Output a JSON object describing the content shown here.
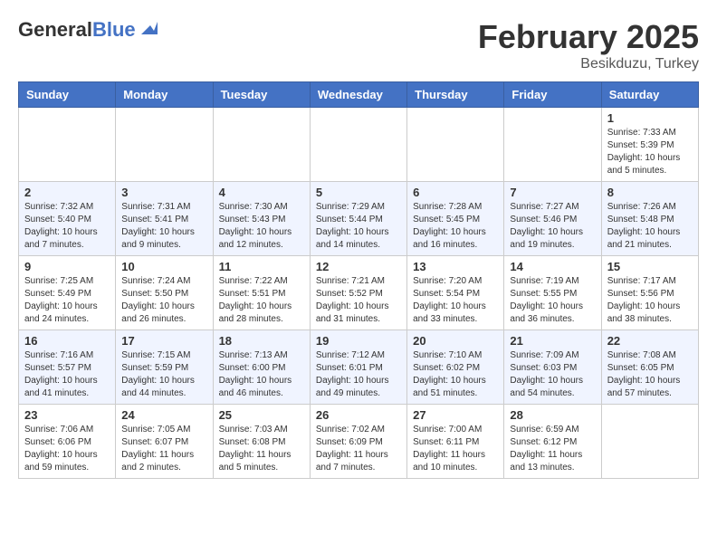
{
  "header": {
    "logo_general": "General",
    "logo_blue": "Blue",
    "month_title": "February 2025",
    "location": "Besikduzu, Turkey"
  },
  "weekdays": [
    "Sunday",
    "Monday",
    "Tuesday",
    "Wednesday",
    "Thursday",
    "Friday",
    "Saturday"
  ],
  "weeks": [
    [
      {
        "day": "",
        "info": ""
      },
      {
        "day": "",
        "info": ""
      },
      {
        "day": "",
        "info": ""
      },
      {
        "day": "",
        "info": ""
      },
      {
        "day": "",
        "info": ""
      },
      {
        "day": "",
        "info": ""
      },
      {
        "day": "1",
        "info": "Sunrise: 7:33 AM\nSunset: 5:39 PM\nDaylight: 10 hours\nand 5 minutes."
      }
    ],
    [
      {
        "day": "2",
        "info": "Sunrise: 7:32 AM\nSunset: 5:40 PM\nDaylight: 10 hours\nand 7 minutes."
      },
      {
        "day": "3",
        "info": "Sunrise: 7:31 AM\nSunset: 5:41 PM\nDaylight: 10 hours\nand 9 minutes."
      },
      {
        "day": "4",
        "info": "Sunrise: 7:30 AM\nSunset: 5:43 PM\nDaylight: 10 hours\nand 12 minutes."
      },
      {
        "day": "5",
        "info": "Sunrise: 7:29 AM\nSunset: 5:44 PM\nDaylight: 10 hours\nand 14 minutes."
      },
      {
        "day": "6",
        "info": "Sunrise: 7:28 AM\nSunset: 5:45 PM\nDaylight: 10 hours\nand 16 minutes."
      },
      {
        "day": "7",
        "info": "Sunrise: 7:27 AM\nSunset: 5:46 PM\nDaylight: 10 hours\nand 19 minutes."
      },
      {
        "day": "8",
        "info": "Sunrise: 7:26 AM\nSunset: 5:48 PM\nDaylight: 10 hours\nand 21 minutes."
      }
    ],
    [
      {
        "day": "9",
        "info": "Sunrise: 7:25 AM\nSunset: 5:49 PM\nDaylight: 10 hours\nand 24 minutes."
      },
      {
        "day": "10",
        "info": "Sunrise: 7:24 AM\nSunset: 5:50 PM\nDaylight: 10 hours\nand 26 minutes."
      },
      {
        "day": "11",
        "info": "Sunrise: 7:22 AM\nSunset: 5:51 PM\nDaylight: 10 hours\nand 28 minutes."
      },
      {
        "day": "12",
        "info": "Sunrise: 7:21 AM\nSunset: 5:52 PM\nDaylight: 10 hours\nand 31 minutes."
      },
      {
        "day": "13",
        "info": "Sunrise: 7:20 AM\nSunset: 5:54 PM\nDaylight: 10 hours\nand 33 minutes."
      },
      {
        "day": "14",
        "info": "Sunrise: 7:19 AM\nSunset: 5:55 PM\nDaylight: 10 hours\nand 36 minutes."
      },
      {
        "day": "15",
        "info": "Sunrise: 7:17 AM\nSunset: 5:56 PM\nDaylight: 10 hours\nand 38 minutes."
      }
    ],
    [
      {
        "day": "16",
        "info": "Sunrise: 7:16 AM\nSunset: 5:57 PM\nDaylight: 10 hours\nand 41 minutes."
      },
      {
        "day": "17",
        "info": "Sunrise: 7:15 AM\nSunset: 5:59 PM\nDaylight: 10 hours\nand 44 minutes."
      },
      {
        "day": "18",
        "info": "Sunrise: 7:13 AM\nSunset: 6:00 PM\nDaylight: 10 hours\nand 46 minutes."
      },
      {
        "day": "19",
        "info": "Sunrise: 7:12 AM\nSunset: 6:01 PM\nDaylight: 10 hours\nand 49 minutes."
      },
      {
        "day": "20",
        "info": "Sunrise: 7:10 AM\nSunset: 6:02 PM\nDaylight: 10 hours\nand 51 minutes."
      },
      {
        "day": "21",
        "info": "Sunrise: 7:09 AM\nSunset: 6:03 PM\nDaylight: 10 hours\nand 54 minutes."
      },
      {
        "day": "22",
        "info": "Sunrise: 7:08 AM\nSunset: 6:05 PM\nDaylight: 10 hours\nand 57 minutes."
      }
    ],
    [
      {
        "day": "23",
        "info": "Sunrise: 7:06 AM\nSunset: 6:06 PM\nDaylight: 10 hours\nand 59 minutes."
      },
      {
        "day": "24",
        "info": "Sunrise: 7:05 AM\nSunset: 6:07 PM\nDaylight: 11 hours\nand 2 minutes."
      },
      {
        "day": "25",
        "info": "Sunrise: 7:03 AM\nSunset: 6:08 PM\nDaylight: 11 hours\nand 5 minutes."
      },
      {
        "day": "26",
        "info": "Sunrise: 7:02 AM\nSunset: 6:09 PM\nDaylight: 11 hours\nand 7 minutes."
      },
      {
        "day": "27",
        "info": "Sunrise: 7:00 AM\nSunset: 6:11 PM\nDaylight: 11 hours\nand 10 minutes."
      },
      {
        "day": "28",
        "info": "Sunrise: 6:59 AM\nSunset: 6:12 PM\nDaylight: 11 hours\nand 13 minutes."
      },
      {
        "day": "",
        "info": ""
      }
    ]
  ]
}
